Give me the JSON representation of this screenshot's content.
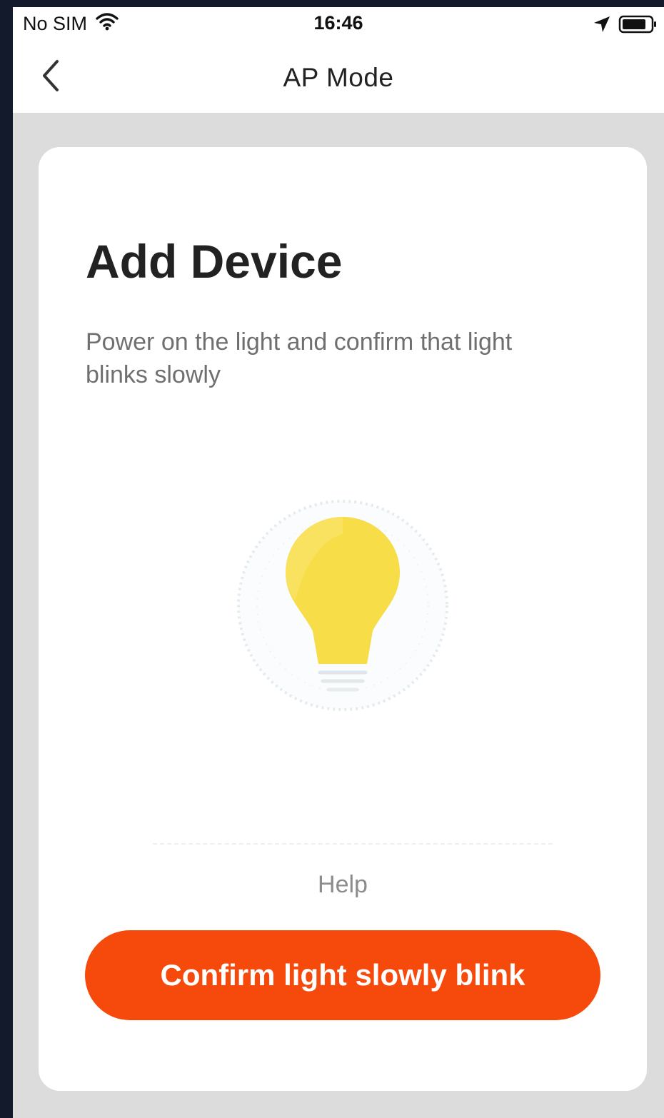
{
  "status_bar": {
    "carrier": "No SIM",
    "time": "16:46",
    "icons": [
      "wifi-icon",
      "location-arrow-icon",
      "battery-icon"
    ]
  },
  "nav": {
    "back_icon": "chevron-left-icon",
    "title": "AP Mode"
  },
  "content": {
    "title": "Add Device",
    "description": "Power on the light and confirm that light blinks slowly",
    "illustration_icon": "light-bulb-icon",
    "help_label": "Help",
    "confirm_label": "Confirm light slowly blink"
  },
  "colors": {
    "accent": "#f6490c",
    "bulb": "#f7dd47",
    "background": "#dcdcdc",
    "card": "#ffffff"
  }
}
